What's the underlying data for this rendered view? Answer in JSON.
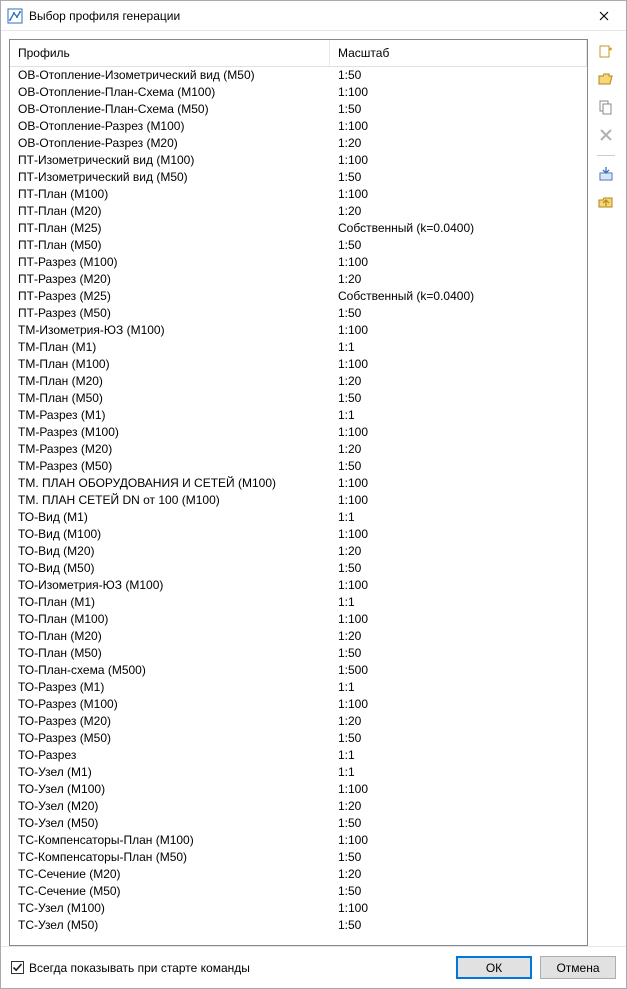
{
  "window": {
    "title": "Выбор профиля генерации"
  },
  "table": {
    "headers": {
      "profile": "Профиль",
      "scale": "Масштаб"
    },
    "rows": [
      {
        "profile": "ОВ-Отопление-Изометрический вид (M50)",
        "scale": "1:50"
      },
      {
        "profile": "ОВ-Отопление-План-Схема (M100)",
        "scale": "1:100"
      },
      {
        "profile": "ОВ-Отопление-План-Схема (M50)",
        "scale": "1:50"
      },
      {
        "profile": "ОВ-Отопление-Разрез (M100)",
        "scale": "1:100"
      },
      {
        "profile": "ОВ-Отопление-Разрез (M20)",
        "scale": "1:20"
      },
      {
        "profile": "ПТ-Изометрический вид (M100)",
        "scale": "1:100"
      },
      {
        "profile": "ПТ-Изометрический вид (M50)",
        "scale": "1:50"
      },
      {
        "profile": "ПТ-План (M100)",
        "scale": "1:100"
      },
      {
        "profile": "ПТ-План (M20)",
        "scale": "1:20"
      },
      {
        "profile": "ПТ-План (M25)",
        "scale": "Собственный (k=0.0400)"
      },
      {
        "profile": "ПТ-План (M50)",
        "scale": "1:50"
      },
      {
        "profile": "ПТ-Разрез (M100)",
        "scale": "1:100"
      },
      {
        "profile": "ПТ-Разрез (M20)",
        "scale": "1:20"
      },
      {
        "profile": "ПТ-Разрез (M25)",
        "scale": "Собственный (k=0.0400)"
      },
      {
        "profile": "ПТ-Разрез (M50)",
        "scale": "1:50"
      },
      {
        "profile": "ТМ-Изометрия-ЮЗ (M100)",
        "scale": "1:100"
      },
      {
        "profile": "ТМ-План (M1)",
        "scale": "1:1"
      },
      {
        "profile": "ТМ-План (M100)",
        "scale": "1:100"
      },
      {
        "profile": "ТМ-План (M20)",
        "scale": "1:20"
      },
      {
        "profile": "ТМ-План (M50)",
        "scale": "1:50"
      },
      {
        "profile": "ТМ-Разрез (M1)",
        "scale": "1:1"
      },
      {
        "profile": "ТМ-Разрез (M100)",
        "scale": "1:100"
      },
      {
        "profile": "ТМ-Разрез (M20)",
        "scale": "1:20"
      },
      {
        "profile": "ТМ-Разрез (M50)",
        "scale": "1:50"
      },
      {
        "profile": "ТМ. ПЛАН ОБОРУДОВАНИЯ И СЕТЕЙ (M100)",
        "scale": "1:100"
      },
      {
        "profile": "ТМ. ПЛАН СЕТЕЙ DN от 100 (M100)",
        "scale": "1:100"
      },
      {
        "profile": "ТО-Вид (M1)",
        "scale": "1:1"
      },
      {
        "profile": "ТО-Вид (M100)",
        "scale": "1:100"
      },
      {
        "profile": "ТО-Вид (M20)",
        "scale": "1:20"
      },
      {
        "profile": "ТО-Вид (M50)",
        "scale": "1:50"
      },
      {
        "profile": "ТО-Изометрия-ЮЗ (M100)",
        "scale": "1:100"
      },
      {
        "profile": "ТО-План (M1)",
        "scale": "1:1"
      },
      {
        "profile": "ТО-План (M100)",
        "scale": "1:100"
      },
      {
        "profile": "ТО-План (M20)",
        "scale": "1:20"
      },
      {
        "profile": "ТО-План (M50)",
        "scale": "1:50"
      },
      {
        "profile": "ТО-План-схема (M500)",
        "scale": "1:500"
      },
      {
        "profile": "ТО-Разрез (M1)",
        "scale": "1:1"
      },
      {
        "profile": "ТО-Разрез (M100)",
        "scale": "1:100"
      },
      {
        "profile": "ТО-Разрез (M20)",
        "scale": "1:20"
      },
      {
        "profile": "ТО-Разрез (M50)",
        "scale": "1:50"
      },
      {
        "profile": "ТО-Разрез",
        "scale": "1:1"
      },
      {
        "profile": "ТО-Узел (M1)",
        "scale": "1:1"
      },
      {
        "profile": "ТО-Узел (M100)",
        "scale": "1:100"
      },
      {
        "profile": "ТО-Узел (M20)",
        "scale": "1:20"
      },
      {
        "profile": "ТО-Узел (M50)",
        "scale": "1:50"
      },
      {
        "profile": "ТС-Компенсаторы-План (M100)",
        "scale": "1:100"
      },
      {
        "profile": "ТС-Компенсаторы-План (M50)",
        "scale": "1:50"
      },
      {
        "profile": "ТС-Сечение (M20)",
        "scale": "1:20"
      },
      {
        "profile": "ТС-Сечение (M50)",
        "scale": "1:50"
      },
      {
        "profile": "ТС-Узел (M100)",
        "scale": "1:100"
      },
      {
        "profile": "ТС-Узел (M50)",
        "scale": "1:50"
      }
    ]
  },
  "footer": {
    "checkbox_label": "Всегда показывать при старте команды",
    "checkbox_checked": true,
    "ok_label": "ОК",
    "cancel_label": "Отмена"
  },
  "toolbar": {
    "items": [
      {
        "name": "new-icon",
        "disabled": false
      },
      {
        "name": "open-icon",
        "disabled": false
      },
      {
        "name": "copy-icon",
        "disabled": false
      },
      {
        "name": "delete-icon",
        "disabled": true
      },
      {
        "name": "import-icon",
        "disabled": false
      },
      {
        "name": "export-icon",
        "disabled": false
      }
    ]
  }
}
